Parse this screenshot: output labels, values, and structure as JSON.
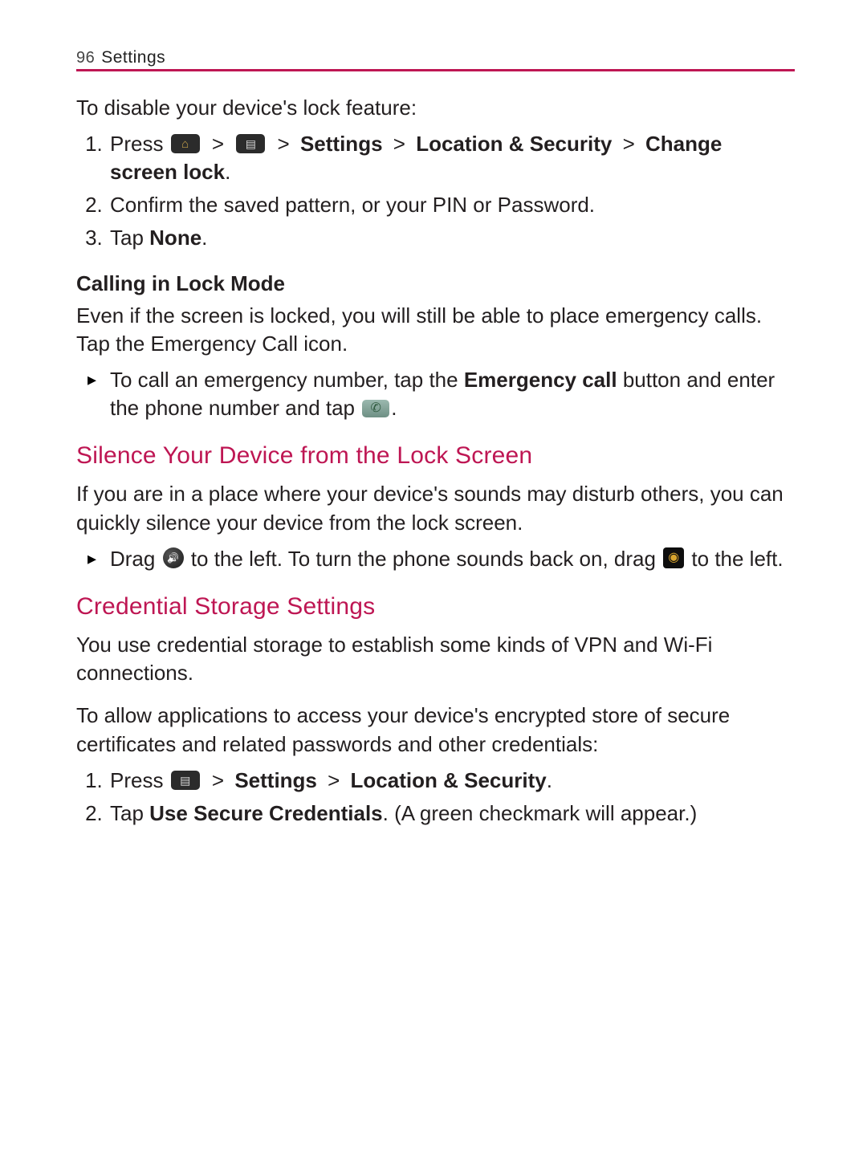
{
  "header": {
    "page_number": "96",
    "section": "Settings"
  },
  "disable_lock": {
    "intro": "To disable your device's lock feature:",
    "step1_prefix": "Press ",
    "step1_mid": " > ",
    "step1_settings": "Settings",
    "step1_loc": "Location & Security",
    "step1_change": "Change screen lock",
    "step1_period": ".",
    "step2": "Confirm the saved pattern, or your PIN or Password.",
    "step3_prefix": "Tap ",
    "step3_bold": "None",
    "step3_suffix": "."
  },
  "calling_lock": {
    "heading": "Calling in Lock Mode",
    "para": "Even if the screen is locked, you will still be able to place emergency calls. Tap the Emergency Call icon.",
    "bullet_prefix": "To call an emergency number, tap the ",
    "bullet_bold": "Emergency call",
    "bullet_mid": " button and enter the phone number and tap ",
    "bullet_suffix": "."
  },
  "silence": {
    "heading": "Silence Your Device from the Lock Screen",
    "para": "If you are in a place where your device's sounds may disturb others, you can quickly silence your device from the lock screen.",
    "bullet_a": "Drag ",
    "bullet_b": " to the left. To turn the phone sounds back on, drag ",
    "bullet_c": " to the left."
  },
  "credential": {
    "heading": "Credential Storage Settings",
    "para": "You use credential storage to establish some kinds of VPN and Wi-Fi connections.",
    "intro": "To allow applications to access your device's encrypted store of secure certificates and related passwords and other credentials:",
    "step1_prefix": "Press ",
    "step1_mid": " > ",
    "step1_settings": "Settings",
    "step1_loc": "Location & Security",
    "step1_suffix": ".",
    "step2_prefix": "Tap ",
    "step2_bold": "Use Secure Credentials",
    "step2_suffix": ". (A green checkmark will appear.)"
  }
}
